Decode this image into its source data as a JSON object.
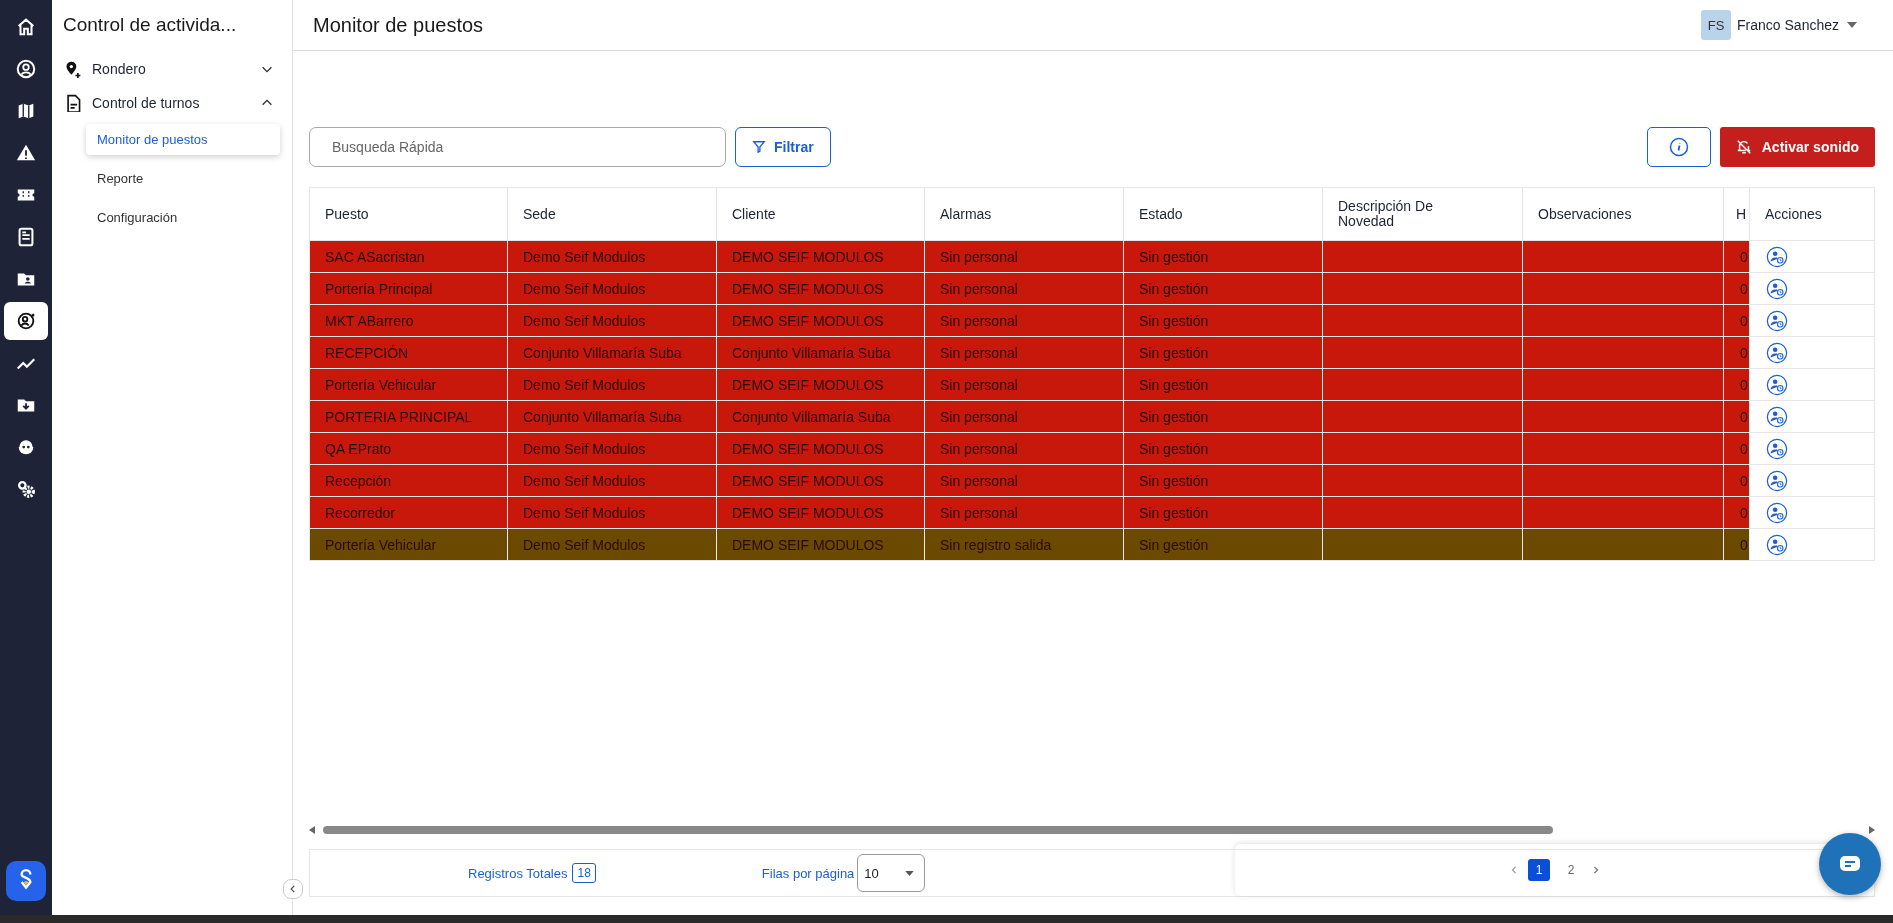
{
  "rail": {
    "items": [
      {
        "selected": false
      },
      {
        "selected": false
      },
      {
        "selected": false
      },
      {
        "selected": false
      },
      {
        "selected": false
      },
      {
        "selected": false
      },
      {
        "selected": false
      },
      {
        "selected": true
      },
      {
        "selected": false
      },
      {
        "selected": false
      },
      {
        "selected": false
      },
      {
        "selected": false
      }
    ]
  },
  "nav": {
    "title": "Control de activida...",
    "items": [
      {
        "label": "Rondero",
        "expanded": false
      },
      {
        "label": "Control de turnos",
        "expanded": true,
        "children": [
          {
            "label": "Monitor de puestos",
            "selected": true
          },
          {
            "label": "Reporte",
            "selected": false
          },
          {
            "label": "Configuración",
            "selected": false
          }
        ]
      }
    ]
  },
  "header": {
    "title": "Monitor de puestos",
    "user_initials": "FS",
    "user_name": "Franco Sanchez"
  },
  "toolbar": {
    "search": {
      "placeholder": "Busqueda Rápida"
    },
    "filter_button": "Filtrar",
    "sound_button": "Activar sonido"
  },
  "table": {
    "columns": [
      "Puesto",
      "Sede",
      "Cliente",
      "Alarmas",
      "Estado",
      "Descripción De Novedad",
      "Observaciones",
      "H",
      "Acciones"
    ],
    "rows": [
      {
        "puesto": "SAC ASacristan",
        "sede": "Demo Seif Modulos",
        "cliente": "DEMO SEIF MODULOS",
        "alarmas": "Sin personal",
        "estado": "Sin gestión",
        "column_8": "0",
        "color": "#c8180b"
      },
      {
        "puesto": "Portería Principal",
        "sede": "Demo Seif Modulos",
        "cliente": "DEMO SEIF MODULOS",
        "alarmas": "Sin personal",
        "estado": "Sin gestión",
        "column_8": "0",
        "color": "#c8180b"
      },
      {
        "puesto": "MKT ABarrero",
        "sede": "Demo Seif Modulos",
        "cliente": "DEMO SEIF MODULOS",
        "alarmas": "Sin personal",
        "estado": "Sin gestión",
        "column_8": "0",
        "color": "#c8180b"
      },
      {
        "puesto": "RECEPCIÓN",
        "sede": "Conjunto Villamaría Suba",
        "cliente": "Conjunto Villamaría Suba",
        "alarmas": "Sin personal",
        "estado": "Sin gestión",
        "column_8": "0",
        "color": "#c8180b"
      },
      {
        "puesto": "Portería Vehicular",
        "sede": "Demo Seif Modulos",
        "cliente": "DEMO SEIF MODULOS",
        "alarmas": "Sin personal",
        "estado": "Sin gestión",
        "column_8": "0",
        "color": "#c8180b"
      },
      {
        "puesto": "PORTERIA PRINCIPAL",
        "sede": "Conjunto Villamaría Suba",
        "cliente": "Conjunto Villamaría Suba",
        "alarmas": "Sin personal",
        "estado": "Sin gestión",
        "column_8": "0",
        "color": "#c8180b"
      },
      {
        "puesto": "QA EPrato",
        "sede": "Demo Seif Modulos",
        "cliente": "DEMO SEIF MODULOS",
        "alarmas": "Sin personal",
        "estado": "Sin gestión",
        "column_8": "0",
        "color": "#c8180b"
      },
      {
        "puesto": "Recepción",
        "sede": "Demo Seif Modulos",
        "cliente": "DEMO SEIF MODULOS",
        "alarmas": "Sin personal",
        "estado": "Sin gestión",
        "column_8": "0",
        "color": "#c8180b"
      },
      {
        "puesto": "Recorredor",
        "sede": "Demo Seif Modulos",
        "cliente": "DEMO SEIF MODULOS",
        "alarmas": "Sin personal",
        "estado": "Sin gestión",
        "column_8": "0",
        "color": "#c8180b"
      },
      {
        "puesto": "Portería Vehicular",
        "sede": "Demo Seif Modulos",
        "cliente": "DEMO SEIF MODULOS",
        "alarmas": "Sin registro salida",
        "estado": "Sin gestión",
        "column_8": "0",
        "color": "#6b4a00"
      }
    ]
  },
  "footer": {
    "total_label": "Registros Totales",
    "total": "18",
    "rows_label": "Filas por página",
    "rows_per_page": "10",
    "pages": [
      {
        "label": "1",
        "selected": true
      },
      {
        "label": "2",
        "selected": false
      }
    ]
  }
}
